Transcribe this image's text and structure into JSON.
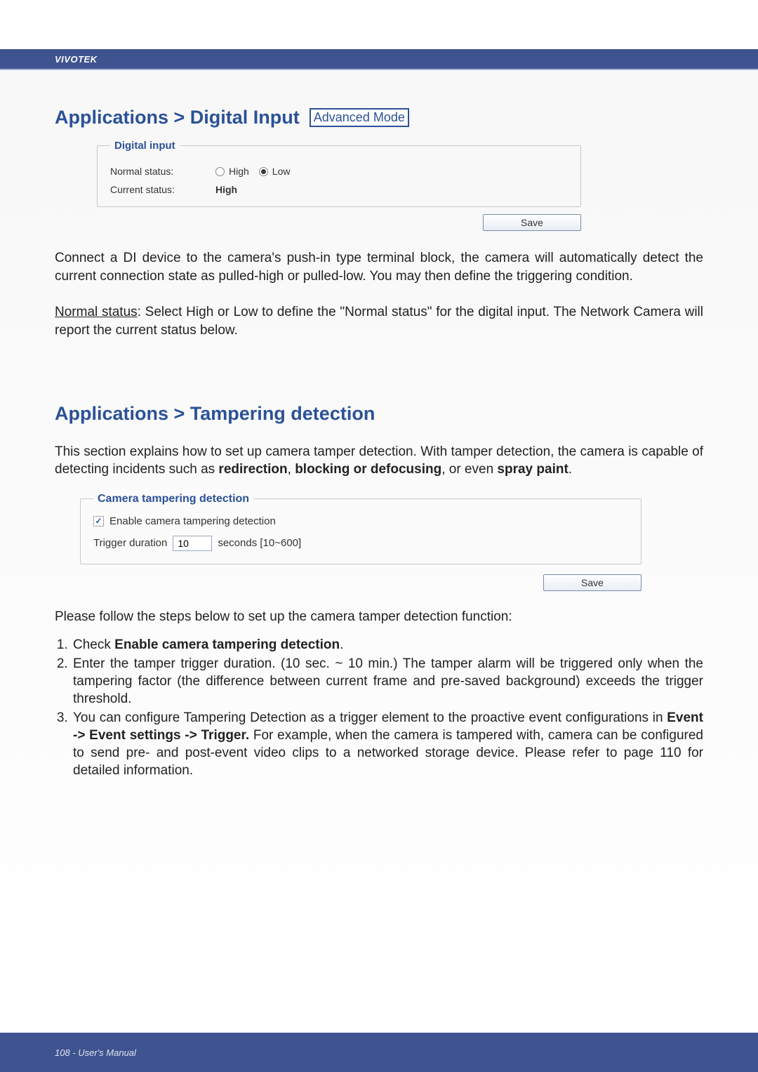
{
  "brand": "VIVOTEK",
  "section1": {
    "title": "Applications > Digital Input",
    "badge": "Advanced Mode",
    "panel_legend": "Digital input",
    "normal_status_label": "Normal status:",
    "radio_high": "High",
    "radio_low": "Low",
    "current_status_label": "Current status:",
    "current_status_value": "High",
    "save_label": "Save",
    "para1": "Connect a DI device to the camera's push-in type terminal block, the camera will automatically detect the current connection state as pulled-high or pulled-low. You may then define the triggering condition.",
    "para2_label": "Normal status",
    "para2_rest": ": Select High or Low to define the \"Normal status\" for the digital input. The Network Camera will report the current status below."
  },
  "section2": {
    "title": "Applications > Tampering detection",
    "intro_a": "This section explains how to set up camera tamper detection. With tamper detection, the camera is capable of detecting incidents such as ",
    "intro_b1": "redirection",
    "intro_sep1": ", ",
    "intro_b2": "blocking or defocusing",
    "intro_sep2": ", or even ",
    "intro_b3": "spray paint",
    "intro_end": ".",
    "panel_legend": "Camera tampering detection",
    "chk_label": "Enable camera tampering detection",
    "dur_label": "Trigger duration",
    "dur_value": "10",
    "dur_suffix": "seconds [10~600]",
    "save_label": "Save",
    "steps_intro": "Please follow the steps below to set up the camera tamper detection function:",
    "step1_a": "Check ",
    "step1_b": "Enable camera tampering detection",
    "step1_c": ".",
    "step2": "Enter the tamper trigger duration. (10 sec. ~ 10 min.) The tamper alarm will be triggered only when the tampering factor (the difference between current frame and pre-saved background) exceeds the trigger threshold.",
    "step3_a": "You can configure Tampering Detection as a trigger element to the proactive event configurations in ",
    "step3_b": "Event -> Event settings -> Trigger.",
    "step3_c": " For example, when the camera is tampered with, camera can be configured to send pre- and post-event video clips to a networked storage device. Please refer to page 110 for detailed information."
  },
  "footer": "108 - User's Manual"
}
